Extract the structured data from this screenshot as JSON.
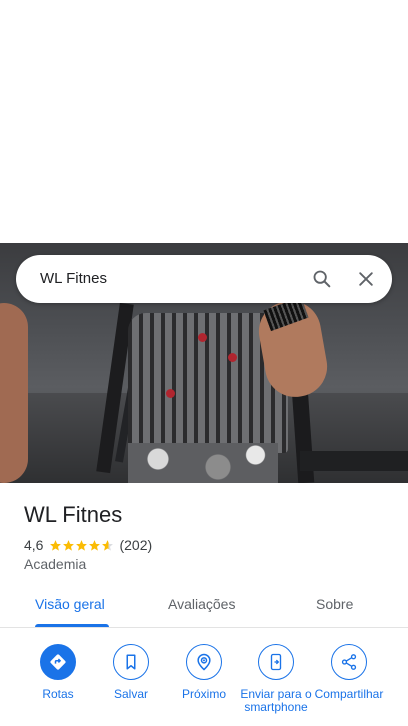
{
  "search": {
    "query": "WL Fitnes"
  },
  "place": {
    "name": "WL Fitnes",
    "rating": "4,6",
    "stars_filled": 4.6,
    "reviews": "(202)",
    "category": "Academia"
  },
  "tabs": [
    {
      "label": "Visão geral",
      "active": true
    },
    {
      "label": "Avaliações",
      "active": false
    },
    {
      "label": "Sobre",
      "active": false
    }
  ],
  "actions": [
    {
      "label": "Rotas",
      "icon": "directions-icon"
    },
    {
      "label": "Salvar",
      "icon": "bookmark-icon"
    },
    {
      "label": "Próximo",
      "icon": "nearby-icon"
    },
    {
      "label": "Enviar para o smartphone",
      "icon": "send-to-phone-icon"
    },
    {
      "label": "Compartilhar",
      "icon": "share-icon"
    }
  ],
  "colors": {
    "accent": "#1a73e8",
    "star": "#fbbc04",
    "text_primary": "#202124",
    "text_secondary": "#5f6368"
  }
}
